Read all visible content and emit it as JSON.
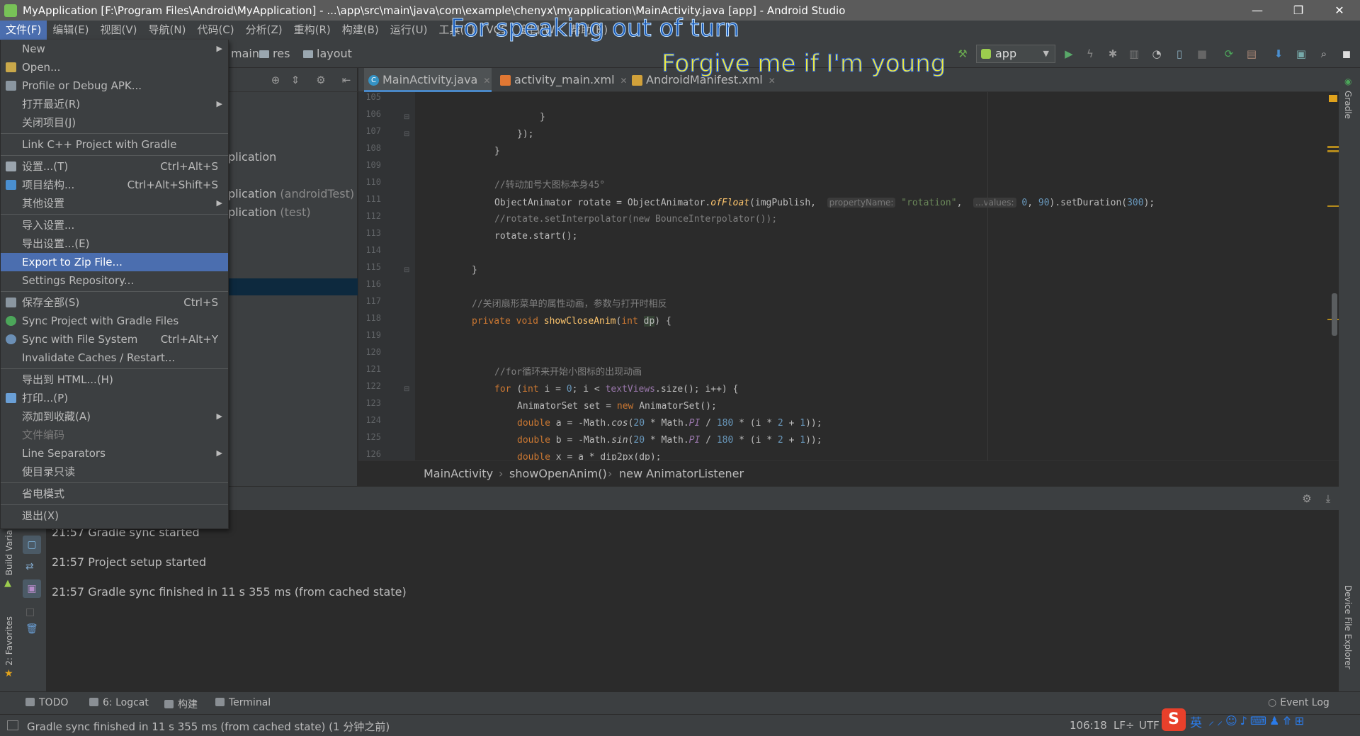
{
  "window": {
    "title": "MyApplication [F:\\Program Files\\Android\\MyApplication] - ...\\app\\src\\main\\java\\com\\example\\chenyx\\myapplication\\MainActivity.java [app] - Android Studio",
    "minimize": "—",
    "restore": "❐",
    "close": "✕"
  },
  "menubar": [
    "文件(F)",
    "编辑(E)",
    "视图(V)",
    "导航(N)",
    "代码(C)",
    "分析(Z)",
    "重构(R)",
    "构建(B)",
    "运行(U)",
    "工具(T)",
    "VCS",
    "窗口(W)",
    "帮助(H)"
  ],
  "breadcrumbs": {
    "main": "main",
    "res": "res",
    "layout": "layout"
  },
  "run_config": "app",
  "lyrics": {
    "line1": "For speaking out of turn",
    "line2": "Forgive me if I'm young"
  },
  "file_menu": [
    {
      "label": "New",
      "submenu": true
    },
    {
      "label": "Open..."
    },
    {
      "label": "Profile or Debug APK..."
    },
    {
      "label": "打开最近(R)",
      "submenu": true
    },
    {
      "label": "关闭项目(J)"
    },
    {
      "label": "Link C++ Project with Gradle"
    },
    {
      "label": "设置...(T)",
      "shortcut": "Ctrl+Alt+S"
    },
    {
      "label": "项目结构...",
      "shortcut": "Ctrl+Alt+Shift+S"
    },
    {
      "label": "其他设置",
      "submenu": true
    },
    {
      "label": "导入设置..."
    },
    {
      "label": "导出设置...(E)"
    },
    {
      "label": "Export to Zip File...",
      "selected": true
    },
    {
      "label": "Settings Repository..."
    },
    {
      "label": "保存全部(S)",
      "shortcut": "Ctrl+S"
    },
    {
      "label": "Sync Project with Gradle Files"
    },
    {
      "label": "Sync with File System",
      "shortcut": "Ctrl+Alt+Y"
    },
    {
      "label": "Invalidate Caches / Restart..."
    },
    {
      "label": "导出到 HTML...(H)"
    },
    {
      "label": "打印...(P)"
    },
    {
      "label": "添加到收藏(A)",
      "submenu": true
    },
    {
      "label": "文件编码",
      "disabled": true
    },
    {
      "label": "Line Separators",
      "submenu": true
    },
    {
      "label": "使目录只读"
    },
    {
      "label": "省电模式"
    },
    {
      "label": "退出(X)"
    }
  ],
  "project_tree": {
    "item1": "plication",
    "item2": "plication",
    "item2_suffix": "(androidTest)",
    "item3": "plication",
    "item3_suffix": "(test)"
  },
  "tabs": [
    {
      "label": "MainActivity.java",
      "active": true
    },
    {
      "label": "activity_main.xml"
    },
    {
      "label": "AndroidManifest.xml"
    }
  ],
  "code": {
    "line_numbers": [
      "105",
      "106",
      "107",
      "108",
      "109",
      "110",
      "111",
      "112",
      "113",
      "114",
      "115",
      "116",
      "117",
      "118",
      "119",
      "120",
      "121",
      "122",
      "123",
      "124",
      "125",
      "126"
    ],
    "l106": "}",
    "l107": "});",
    "l108": "}",
    "l110": "//转动加号大图标本身45°",
    "l111_a": "ObjectAnimator rotate = ObjectAnimator.",
    "l111_fn": "ofFloat",
    "l111_b": "(imgPublish, ",
    "l111_hint1": "propertyName:",
    "l111_str": "\"rotation\"",
    "l111_c": ", ",
    "l111_hint2": "...values:",
    "l111_n1": "0",
    "l111_d": ", ",
    "l111_n2": "90",
    "l111_e": ").setDuration(",
    "l111_n3": "300",
    "l111_f": ");",
    "l112": "//rotate.setInterpolator(new BounceInterpolator());",
    "l113": "rotate.start();",
    "l115": "}",
    "l117": "//关闭扇形菜单的属性动画，参数与打开时相反",
    "l118_kw": "private void ",
    "l118_fn": "showCloseAnim",
    "l118_a": "(",
    "l118_kw2": "int ",
    "l118_dp": "dp",
    "l118_b": ") {",
    "l121": "//for循环来开始小图标的出现动画",
    "l122_kw": "for ",
    "l122_a": "(",
    "l122_kw2": "int ",
    "l122_b": "i = ",
    "l122_n": "0",
    "l122_c": "; i < ",
    "l122_fld": "textViews",
    "l122_d": ".size(); i++) {",
    "l123_a": "AnimatorSet set = ",
    "l123_kw": "new ",
    "l123_b": "AnimatorSet();",
    "l124_kw": "double ",
    "l124_a": "a = -Math.",
    "l124_fn": "cos",
    "l124_b": "(",
    "l124_n1": "20",
    "l124_c": " * Math.",
    "l124_pi": "PI",
    "l124_d": " / ",
    "l124_n2": "180",
    "l124_e": " * (i * ",
    "l124_n3": "2",
    "l124_f": " + ",
    "l124_n4": "1",
    "l124_g": "));",
    "l125_kw": "double ",
    "l125_a": "b = -Math.",
    "l125_fn": "sin",
    "l125_b": "(",
    "l125_n1": "20",
    "l125_c": " * Math.",
    "l125_pi": "PI",
    "l125_d": " / ",
    "l125_n2": "180",
    "l125_e": " * (i * ",
    "l125_n3": "2",
    "l125_f": " + ",
    "l125_n4": "1",
    "l125_g": "));",
    "l126_kw": "double ",
    "l126_a": "x = a * dip2px(dp);"
  },
  "editor_breadcrumbs": [
    "MainActivity",
    "showOpenAnim()",
    "new AnimatorListener"
  ],
  "log": [
    "21:57 Gradle sync started",
    "21:57 Project setup started",
    "21:57 Gradle sync finished in 11 s 355 ms (from cached state)"
  ],
  "side_labels": {
    "gradle": "Gradle",
    "device_explorer": "Device File Explorer",
    "build_variants": "Build Varia",
    "favorites": "2: Favorites"
  },
  "tool_windows": [
    "TODO",
    "6: Logcat",
    "构建",
    "Terminal"
  ],
  "event_log": "Event Log",
  "status": {
    "message": "Gradle sync finished in 11 s 355 ms (from cached state) (1 分钟之前)",
    "position": "106:18",
    "line_sep": "LF÷",
    "encoding": "UTF",
    "ime_lang": "英"
  },
  "colors": {
    "accent": "#4b6eaf",
    "bg": "#2b2b2b",
    "panel": "#3c3f41"
  }
}
